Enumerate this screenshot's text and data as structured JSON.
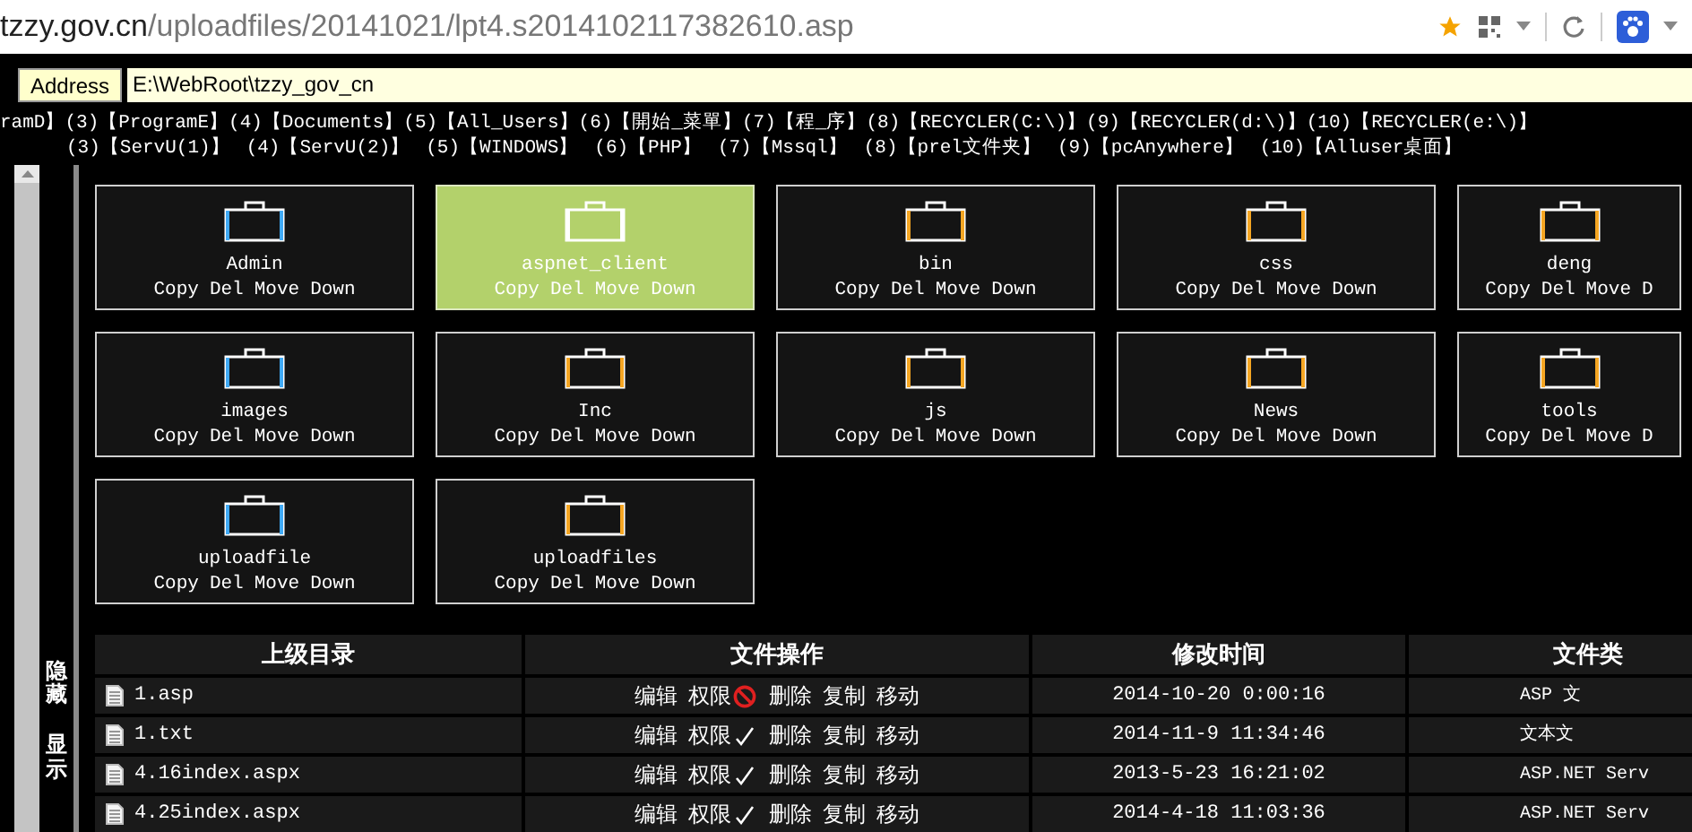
{
  "browser": {
    "url_host": "tzzy.gov.cn",
    "url_path": "/uploadfiles/20141021/lpt4.s2014102117382610.asp"
  },
  "address": {
    "label": "Address",
    "value": "E:\\WebRoot\\tzzy_gov_cn"
  },
  "drive_links": [
    [
      "ramD】",
      "(3)【ProgramE】",
      "(4)【Documents】",
      "(5)【All_Users】",
      "(6)【開始_菜單】",
      "(7)【程_序】",
      "(8)【RECYCLER(C:\\)】",
      "(9)【RECYCLER(d:\\)】",
      "(10)【RECYCLER(e:\\)】"
    ],
    [
      "(3)【ServU(1)】",
      "(4)【ServU(2)】",
      "(5)【WINDOWS】",
      "(6)【PHP】",
      "(7)【Mssql】",
      "(8)【prel文件夹】",
      "(9)【pcAnywhere】",
      "(10)【Alluser桌面】"
    ]
  ],
  "sidebar": {
    "hide": "隐藏",
    "show": "显示"
  },
  "folders": [
    {
      "name": "Admin",
      "actions": [
        "Copy",
        "Del",
        "Move",
        "Down"
      ],
      "selected": false,
      "color": "#3fa9f5"
    },
    {
      "name": "aspnet_client",
      "actions": [
        "Copy",
        "Del",
        "Move",
        "Down"
      ],
      "selected": true,
      "color": "#ffffff"
    },
    {
      "name": "bin",
      "actions": [
        "Copy",
        "Del",
        "Move",
        "Down"
      ],
      "selected": false,
      "color": "#f5a623"
    },
    {
      "name": "css",
      "actions": [
        "Copy",
        "Del",
        "Move",
        "Down"
      ],
      "selected": false,
      "color": "#f5a623"
    },
    {
      "name": "deng",
      "actions": [
        "Copy",
        "Del",
        "Move",
        "D"
      ],
      "selected": false,
      "color": "#f5a623"
    },
    {
      "name": "images",
      "actions": [
        "Copy",
        "Del",
        "Move",
        "Down"
      ],
      "selected": false,
      "color": "#3fa9f5"
    },
    {
      "name": "Inc",
      "actions": [
        "Copy",
        "Del",
        "Move",
        "Down"
      ],
      "selected": false,
      "color": "#f5a623"
    },
    {
      "name": "js",
      "actions": [
        "Copy",
        "Del",
        "Move",
        "Down"
      ],
      "selected": false,
      "color": "#f5a623"
    },
    {
      "name": "News",
      "actions": [
        "Copy",
        "Del",
        "Move",
        "Down"
      ],
      "selected": false,
      "color": "#f5a623"
    },
    {
      "name": "tools",
      "actions": [
        "Copy",
        "Del",
        "Move",
        "D"
      ],
      "selected": false,
      "color": "#f5a623"
    },
    {
      "name": "uploadfile",
      "actions": [
        "Copy",
        "Del",
        "Move",
        "Down"
      ],
      "selected": false,
      "color": "#3fa9f5"
    },
    {
      "name": "uploadfiles",
      "actions": [
        "Copy",
        "Del",
        "Move",
        "Down"
      ],
      "selected": false,
      "color": "#f5a623"
    }
  ],
  "table": {
    "columns": [
      "上级目录",
      "文件操作",
      "修改时间",
      "文件类"
    ],
    "rows": [
      {
        "name": "1.asp",
        "edit": "编辑",
        "perm": "权限",
        "permitted": false,
        "delete": "删除",
        "copy": "复制",
        "move": "移动",
        "modified": "2014-10-20 0:00:16",
        "type": "ASP 文"
      },
      {
        "name": "1.txt",
        "edit": "编辑",
        "perm": "权限",
        "permitted": true,
        "delete": "删除",
        "copy": "复制",
        "move": "移动",
        "modified": "2014-11-9 11:34:46",
        "type": "文本文"
      },
      {
        "name": "4.16index.aspx",
        "edit": "编辑",
        "perm": "权限",
        "permitted": true,
        "delete": "删除",
        "copy": "复制",
        "move": "移动",
        "modified": "2013-5-23 16:21:02",
        "type": "ASP.NET Serv"
      },
      {
        "name": "4.25index.aspx",
        "edit": "编辑",
        "perm": "权限",
        "permitted": true,
        "delete": "删除",
        "copy": "复制",
        "move": "移动",
        "modified": "2014-4-18 11:03:36",
        "type": "ASP.NET Serv"
      }
    ]
  }
}
